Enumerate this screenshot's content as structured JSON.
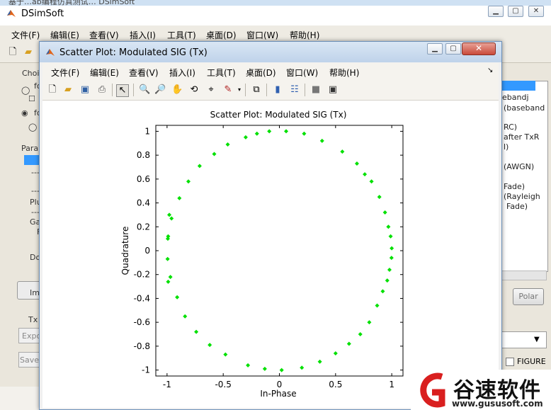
{
  "background_window": {
    "top_strip_text": "基于…ab编程仿真测试… DSimSoft",
    "title": "DSimSoft",
    "menu": [
      "文件(F)",
      "编辑(E)",
      "查看(V)",
      "插入(I)",
      "工具(T)",
      "桌面(D)",
      "窗口(W)",
      "帮助(H)"
    ],
    "left_fragments": [
      "Choi",
      "fo",
      "fo",
      "Para",
      "---",
      "---",
      "Plu",
      "---",
      "Ga",
      "F",
      "Do",
      "Im",
      "Tx",
      "Expo",
      "Save"
    ],
    "right_list": [
      "ebandj",
      "(baseband",
      "RC)",
      "after TxR",
      "l)",
      "(AWGN)",
      "Fade)",
      "(Rayleigh",
      "Fade)"
    ],
    "polar_button": "Polar",
    "figure_checkbox_label": "FIGURE"
  },
  "figure_window": {
    "title": "Scatter Plot: Modulated SIG (Tx)",
    "menu": [
      "文件(F)",
      "编辑(E)",
      "查看(V)",
      "插入(I)",
      "工具(T)",
      "桌面(D)",
      "窗口(W)",
      "帮助(H)"
    ],
    "close_icon": "close-icon"
  },
  "chart_data": {
    "type": "scatter",
    "title": "Scatter Plot: Modulated SIG (Tx)",
    "xlabel": "In-Phase",
    "ylabel": "Quadrature",
    "xlim": [
      -1.1,
      1.1
    ],
    "ylim": [
      -1.05,
      1.05
    ],
    "xticks": [
      "-1",
      "-0.5",
      "0",
      "0.5",
      "1"
    ],
    "yticks": [
      "-1",
      "-0.8",
      "-0.6",
      "-0.4",
      "-0.2",
      "0",
      "0.2",
      "0.4",
      "0.6",
      "0.8",
      "1"
    ],
    "grid": false,
    "marker_color": "#00e000",
    "series": [
      {
        "points": [
          [
            1.0,
            0.02
          ],
          [
            0.998,
            -0.06
          ],
          [
            0.99,
            0.12
          ],
          [
            0.98,
            -0.16
          ],
          [
            0.97,
            0.2
          ],
          [
            0.96,
            -0.25
          ],
          [
            0.94,
            0.32
          ],
          [
            0.92,
            -0.34
          ],
          [
            0.89,
            0.45
          ],
          [
            0.87,
            -0.46
          ],
          [
            0.82,
            0.58
          ],
          [
            0.8,
            -0.6
          ],
          [
            0.76,
            0.64
          ],
          [
            0.72,
            -0.7
          ],
          [
            0.69,
            0.73
          ],
          [
            0.62,
            -0.78
          ],
          [
            0.56,
            0.83
          ],
          [
            0.5,
            -0.86
          ],
          [
            0.38,
            0.92
          ],
          [
            0.36,
            -0.93
          ],
          [
            0.22,
            0.98
          ],
          [
            0.2,
            -0.98
          ],
          [
            0.06,
            1.0
          ],
          [
            0.02,
            -1.0
          ],
          [
            -0.09,
            1.0
          ],
          [
            -0.13,
            -0.99
          ],
          [
            -0.2,
            0.98
          ],
          [
            -0.28,
            -0.96
          ],
          [
            -0.3,
            0.95
          ],
          [
            -0.46,
            0.89
          ],
          [
            -0.48,
            -0.87
          ],
          [
            -0.58,
            0.81
          ],
          [
            -0.62,
            -0.79
          ],
          [
            -0.71,
            0.71
          ],
          [
            -0.74,
            -0.68
          ],
          [
            -0.81,
            0.58
          ],
          [
            -0.84,
            -0.55
          ],
          [
            -0.89,
            0.44
          ],
          [
            -0.91,
            -0.39
          ],
          [
            -0.96,
            0.27
          ],
          [
            -0.97,
            -0.22
          ],
          [
            -0.99,
            0.12
          ],
          [
            -0.995,
            -0.07
          ],
          [
            -0.98,
            0.3
          ],
          [
            -0.99,
            -0.26
          ],
          [
            -0.993,
            0.1
          ]
        ]
      }
    ]
  },
  "watermark": {
    "text": "谷速软件",
    "url": "www.gususoft.com"
  }
}
